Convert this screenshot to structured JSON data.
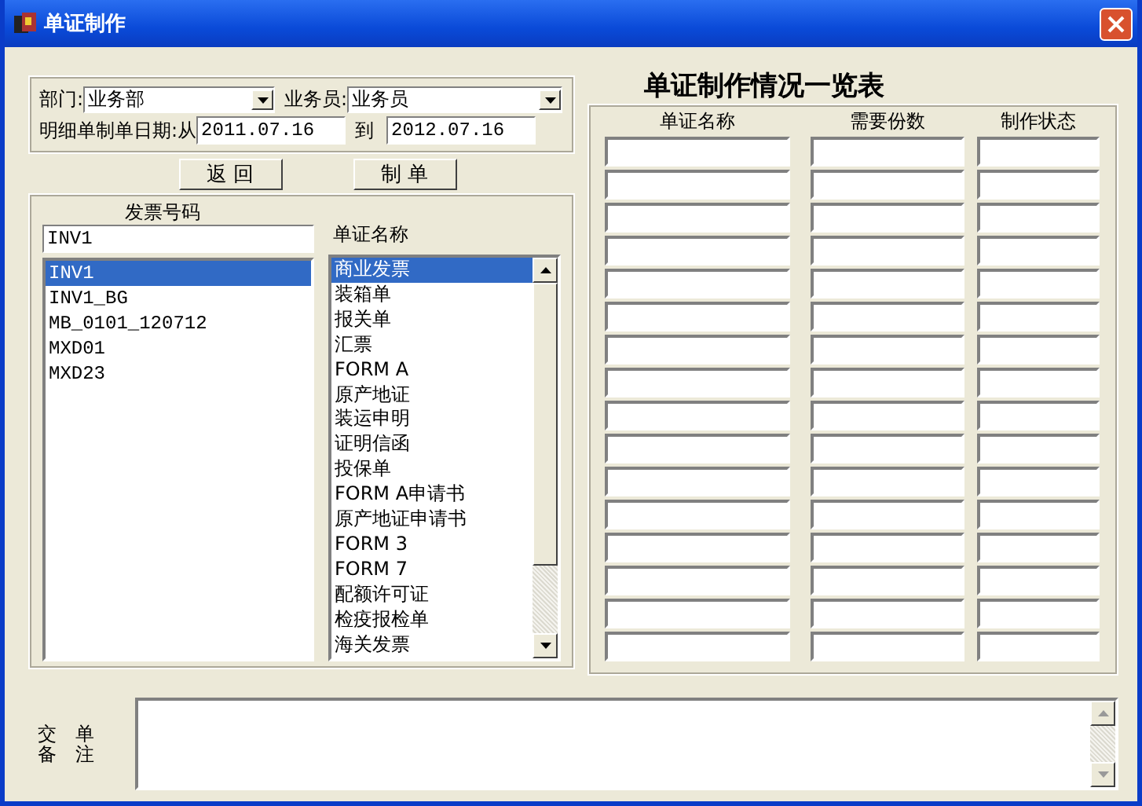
{
  "window": {
    "title": "单证制作"
  },
  "filters": {
    "department_label": "部门:",
    "department": "业务部",
    "salesman_label": "业务员:",
    "salesman": "业务员",
    "date_label": "明细单制单日期:从",
    "date_from": "2011.07.16",
    "date_to_label": "到",
    "date_to": "2012.07.16"
  },
  "buttons": [
    "返 回",
    "制 单"
  ],
  "invoices": {
    "heading": "发票号码",
    "value": "INV1",
    "items": [
      {
        "label": "INV1",
        "selected": true
      },
      {
        "label": "INV1_BG",
        "selected": false
      },
      {
        "label": "MB_0101_120712",
        "selected": false
      },
      {
        "label": "MXD01",
        "selected": false
      },
      {
        "label": "MXD23",
        "selected": false
      }
    ]
  },
  "documents": {
    "heading": "单证名称",
    "items": [
      {
        "label": "商业发票",
        "selected": true
      },
      {
        "label": "装箱单",
        "selected": false
      },
      {
        "label": "报关单",
        "selected": false
      },
      {
        "label": "汇票",
        "selected": false
      },
      {
        "label": "FORM A",
        "selected": false
      },
      {
        "label": "原产地证",
        "selected": false
      },
      {
        "label": "装运申明",
        "selected": false
      },
      {
        "label": "证明信函",
        "selected": false
      },
      {
        "label": "投保单",
        "selected": false
      },
      {
        "label": "FORM A申请书",
        "selected": false
      },
      {
        "label": "原产地证申请书",
        "selected": false
      },
      {
        "label": "FORM 3",
        "selected": false
      },
      {
        "label": "FORM 7",
        "selected": false
      },
      {
        "label": "配额许可证",
        "selected": false
      },
      {
        "label": "检疫报检单",
        "selected": false
      },
      {
        "label": "海关发票",
        "selected": false
      }
    ]
  },
  "summary": {
    "title": "单证制作情况一览表",
    "columns": [
      "单证名称",
      "需要份数",
      "制作状态"
    ]
  },
  "remarks": {
    "label": "交单备注"
  }
}
